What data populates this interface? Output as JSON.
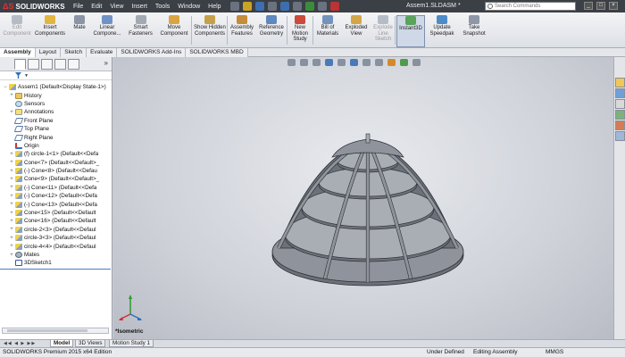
{
  "titlebar": {
    "brand": "SOLIDWORKS",
    "brand_mark": "ΔS",
    "menus": [
      "File",
      "Edit",
      "View",
      "Insert",
      "Tools",
      "Window",
      "Help"
    ],
    "document_title": "Assem1.SLDASM *",
    "search_placeholder": "Search Commands",
    "window_controls": [
      "_",
      "□",
      "×"
    ]
  },
  "ribbon": {
    "buttons": [
      {
        "label": "Edit Component",
        "icon": "edit-component-icon",
        "disabled": true,
        "color": "#b6bcc6"
      },
      {
        "label": "Insert Components",
        "icon": "insert-components-icon",
        "disabled": false,
        "color": "#e2b640"
      },
      {
        "label": "Mate",
        "icon": "mate-icon",
        "disabled": false,
        "color": "#8c95a5"
      },
      {
        "label": "Linear Compone...",
        "icon": "linear-pattern-icon",
        "disabled": false,
        "color": "#6f93c4"
      },
      {
        "label": "Smart Fasteners",
        "icon": "smart-fasteners-icon",
        "disabled": false,
        "color": "#a3a9b3"
      },
      {
        "label": "Move Component",
        "icon": "move-component-icon",
        "disabled": false,
        "color": "#d9a441"
      },
      {
        "label": "Show Hidden Components",
        "icon": "show-hidden-icon",
        "disabled": false,
        "color": "#c5a04b"
      },
      {
        "label": "Assembly Features",
        "icon": "assembly-features-icon",
        "disabled": false,
        "color": "#c58c3a"
      },
      {
        "label": "Reference Geometry",
        "icon": "reference-geometry-icon",
        "disabled": false,
        "color": "#5f87c0"
      },
      {
        "label": "New Motion Study",
        "icon": "motion-study-icon",
        "disabled": false,
        "color": "#cc4a3a"
      },
      {
        "label": "Bill of Materials",
        "icon": "bill-of-materials-icon",
        "disabled": false,
        "color": "#7393bd"
      },
      {
        "label": "Exploded View",
        "icon": "exploded-view-icon",
        "disabled": false,
        "color": "#d4a547"
      },
      {
        "label": "Explode Line Sketch",
        "icon": "explode-line-sketch-icon",
        "disabled": true,
        "color": "#b6bcc6"
      },
      {
        "label": "Instant3D",
        "icon": "instant3d-icon",
        "disabled": false,
        "active": true,
        "color": "#5aa35a"
      },
      {
        "label": "Update Speedpak",
        "icon": "speedpak-icon",
        "disabled": false,
        "color": "#4d8cc8"
      },
      {
        "label": "Take Snapshot",
        "icon": "snapshot-icon",
        "disabled": false,
        "color": "#8d97a6"
      }
    ]
  },
  "command_tabs": [
    "Assembly",
    "Layout",
    "Sketch",
    "Evaluate",
    "SOLIDWORKS Add-Ins",
    "SOLIDWORKS MBD"
  ],
  "feature_tree": {
    "more_glyph": "»",
    "filter_arrow": "▼",
    "nodes": [
      {
        "label": "Assem1  (Default<Display State-1>)",
        "icon": "assembly-icon",
        "type": "comp",
        "expander": "−",
        "level": "root"
      },
      {
        "label": "History",
        "icon": "history-folder-icon",
        "type": "folder",
        "expander": "+",
        "level": "indent1"
      },
      {
        "label": "Sensors",
        "icon": "sensors-icon",
        "type": "sensor",
        "expander": "",
        "level": "indent1"
      },
      {
        "label": "Annotations",
        "icon": "annotations-icon",
        "type": "ann",
        "expander": "+",
        "level": "indent1"
      },
      {
        "label": "Front Plane",
        "icon": "plane-icon",
        "type": "plane",
        "expander": "",
        "level": "indent1"
      },
      {
        "label": "Top Plane",
        "icon": "plane-icon",
        "type": "plane",
        "expander": "",
        "level": "indent1"
      },
      {
        "label": "Right Plane",
        "icon": "plane-icon",
        "type": "plane",
        "expander": "",
        "level": "indent1"
      },
      {
        "label": "Origin",
        "icon": "origin-icon",
        "type": "origin",
        "expander": "",
        "level": "indent1"
      },
      {
        "label": "(f) circle-1<1> (Default<<Defa",
        "icon": "part-icon",
        "type": "comp",
        "expander": "+",
        "level": "indent1"
      },
      {
        "label": "Cone<7> (Default<<Default>_",
        "icon": "part-icon",
        "type": "comp",
        "expander": "+",
        "level": "indent1"
      },
      {
        "label": "(-) Cone<8> (Default<<Defau",
        "icon": "part-icon",
        "type": "comp",
        "expander": "+",
        "level": "indent1"
      },
      {
        "label": "Cone<9> (Default<<Default>_",
        "icon": "part-icon",
        "type": "comp",
        "expander": "+",
        "level": "indent1"
      },
      {
        "label": "(-) Cone<11> (Default<<Defa",
        "icon": "part-icon",
        "type": "comp",
        "expander": "+",
        "level": "indent1"
      },
      {
        "label": "(-) Cone<12> (Default<<Defa",
        "icon": "part-icon",
        "type": "comp",
        "expander": "+",
        "level": "indent1"
      },
      {
        "label": "(-) Cone<13> (Default<<Defa",
        "icon": "part-icon",
        "type": "comp",
        "expander": "+",
        "level": "indent1"
      },
      {
        "label": "Cone<15> (Default<<Default",
        "icon": "part-icon",
        "type": "comp",
        "expander": "+",
        "level": "indent1"
      },
      {
        "label": "Cone<16> (Default<<Default",
        "icon": "part-icon",
        "type": "comp",
        "expander": "+",
        "level": "indent1"
      },
      {
        "label": "circle-2<3> (Default<<Defaul",
        "icon": "part-icon",
        "type": "comp",
        "expander": "+",
        "level": "indent1"
      },
      {
        "label": "circle-3<3> (Default<<Defaul",
        "icon": "part-icon",
        "type": "comp",
        "expander": "+",
        "level": "indent1"
      },
      {
        "label": "circle-4<4> (Default<<Defaul",
        "icon": "part-icon",
        "type": "comp",
        "expander": "+",
        "level": "indent1"
      },
      {
        "label": "Mates",
        "icon": "mates-icon",
        "type": "mates",
        "expander": "+",
        "level": "indent1"
      },
      {
        "label": "3DSketch1",
        "icon": "sketch-icon",
        "type": "sketch",
        "expander": "",
        "level": "indent1"
      }
    ]
  },
  "viewport": {
    "view_label": "*Isometric",
    "model_colors": {
      "face": "#8f939b",
      "light": "#a9adb4",
      "dark": "#6c7078",
      "edge": "#2c2f35"
    }
  },
  "bottom_tabs": {
    "nav": "◀◀ ◀ ▶ ▶▶",
    "tabs": [
      "Model",
      "3D Views",
      "Motion Study 1"
    ]
  },
  "statusbar": {
    "edition": "SOLIDWORKS Premium 2015 x64 Edition",
    "state": "Under Defined",
    "mode": "Editing Assembly",
    "units": "MMGS"
  }
}
